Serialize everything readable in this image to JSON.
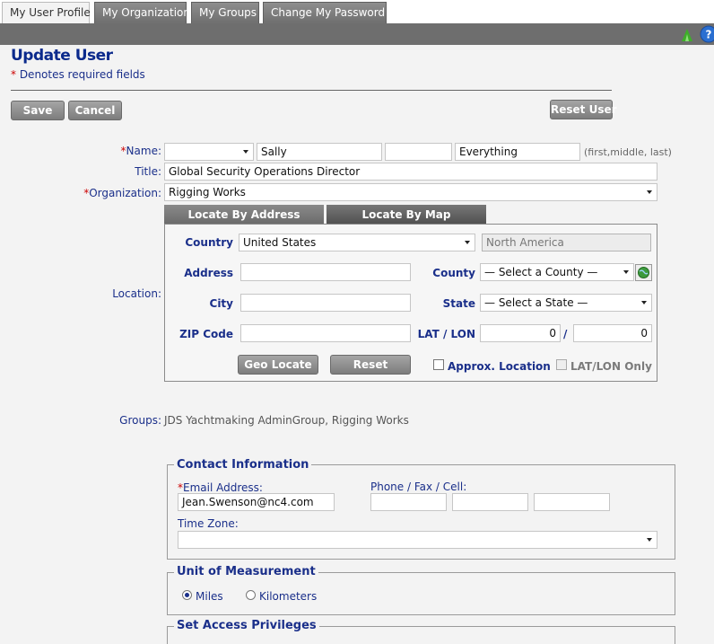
{
  "tabs": [
    {
      "label": "My User Profile",
      "active": true
    },
    {
      "label": "My Organization",
      "active": false
    },
    {
      "label": "My Groups",
      "active": false
    },
    {
      "label": "Change My Password",
      "active": false
    }
  ],
  "page": {
    "title": "Update User",
    "required_star": "*",
    "required_note": " Denotes required fields"
  },
  "buttons": {
    "save": "Save",
    "cancel": "Cancel",
    "reset_user": "Reset User"
  },
  "name": {
    "label": "Name:",
    "prefix": "",
    "first": "Sally",
    "middle": "",
    "last": "Everything",
    "hint": "(first,middle, last)"
  },
  "title_field": {
    "label": "Title:",
    "value": "Global Security Operations Director"
  },
  "organization": {
    "label": "Organization:",
    "value": "Rigging Works"
  },
  "location": {
    "label": "Location:",
    "tabs": {
      "address": "Locate By Address",
      "map": "Locate By Map"
    },
    "country_label": "Country",
    "country_value": "United States",
    "region_value": "North America",
    "address_label": "Address",
    "address_value": "",
    "county_label": "County",
    "county_value": "— Select a County —",
    "city_label": "City",
    "city_value": "",
    "state_label": "State",
    "state_value": "— Select a State —",
    "zip_label": "ZIP Code",
    "zip_value": "",
    "latlon_label": "LAT / LON",
    "lat_value": "0",
    "lon_value": "0",
    "slash": "/",
    "geo_locate": "Geo Locate",
    "reset": "Reset",
    "approx_label": "Approx. Location",
    "latlon_only_label": "LAT/LON Only"
  },
  "groups": {
    "label": "Groups:",
    "value": "JDS Yachtmaking AdminGroup, Rigging Works"
  },
  "contact": {
    "legend": "Contact Information",
    "email_label": "Email Address:",
    "email_value": "Jean.Swenson@nc4.com",
    "phone_label": "Phone / Fax / Cell:",
    "phone_value": "",
    "fax_value": "",
    "cell_value": "",
    "timezone_label": "Time Zone:",
    "timezone_value": ""
  },
  "units": {
    "legend": "Unit of Measurement",
    "miles": "Miles",
    "kilometers": "Kilometers",
    "selected": "Miles"
  },
  "access": {
    "legend": "Set Access Privileges"
  },
  "icons": [
    "back-arrow-icon",
    "help-icon",
    "globe-icon"
  ]
}
